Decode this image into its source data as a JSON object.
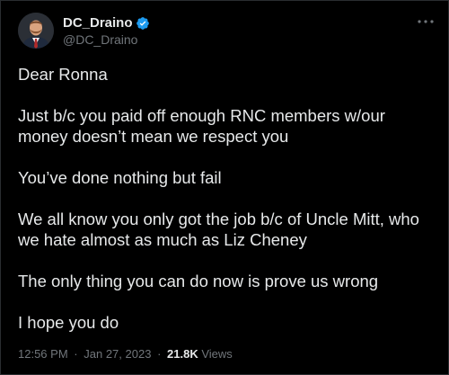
{
  "author": {
    "display_name": "DC_Draino",
    "handle": "@DC_Draino",
    "verified": true
  },
  "tweet": {
    "paragraphs": [
      "Dear Ronna",
      "Just b/c you paid off enough RNC members w/our money doesn’t mean we respect you",
      "You’ve done nothing but fail",
      "We all know you only got the job b/c of Uncle Mitt, who we hate almost as much as Liz Cheney",
      "The only thing you can do now is prove us wrong",
      "I hope you do"
    ],
    "time": "12:56 PM",
    "date": "Jan 27, 2023",
    "separator": "·",
    "views_count": "21.8K",
    "views_label": "Views"
  },
  "colors": {
    "background": "#000000",
    "text": "#e7e9ea",
    "secondary_text": "#71767b",
    "verified_badge": "#1d9bf0"
  },
  "icons": {
    "verified": "verified-badge-icon",
    "more": "more-options-icon"
  }
}
